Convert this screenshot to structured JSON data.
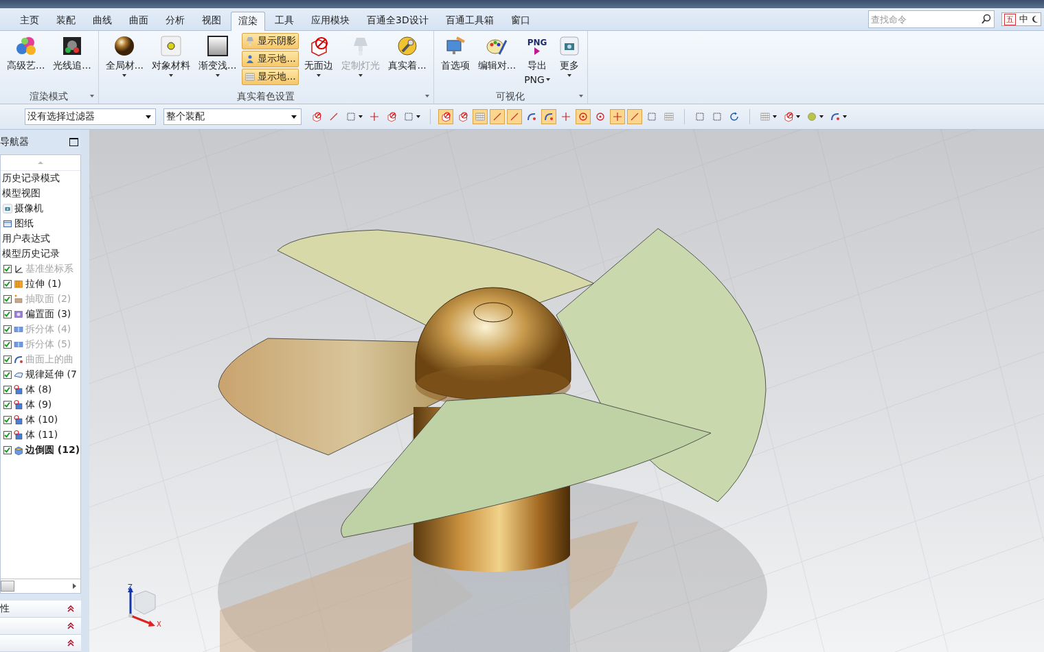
{
  "tabs": [
    {
      "label": "主页",
      "selected": false
    },
    {
      "label": "装配",
      "selected": false
    },
    {
      "label": "曲线",
      "selected": false
    },
    {
      "label": "曲面",
      "selected": false
    },
    {
      "label": "分析",
      "selected": false
    },
    {
      "label": "视图",
      "selected": false
    },
    {
      "label": "渲染",
      "selected": true
    },
    {
      "label": "工具",
      "selected": false
    },
    {
      "label": "应用模块",
      "selected": false
    },
    {
      "label": "百通全3D设计",
      "selected": false
    },
    {
      "label": "百通工具箱",
      "selected": false
    },
    {
      "label": "窗口",
      "selected": false
    }
  ],
  "search": {
    "placeholder": "查找命令"
  },
  "ime": {
    "labels": [
      "五",
      "中"
    ]
  },
  "ribbon": {
    "groups": [
      {
        "label": "渲染模式",
        "items": [
          {
            "kind": "large",
            "label": "高级艺...",
            "disabled": false,
            "dropdown": false
          },
          {
            "kind": "large",
            "label": "光线追...",
            "disabled": false,
            "dropdown": false
          }
        ]
      },
      {
        "label": "真实着色设置",
        "items": [
          {
            "kind": "large",
            "label": "全局材...",
            "disabled": false,
            "dropdown": true
          },
          {
            "kind": "large",
            "label": "对象材料",
            "disabled": false,
            "dropdown": true
          },
          {
            "kind": "large",
            "label": "渐变浅...",
            "disabled": false,
            "dropdown": true
          },
          {
            "kind": "stack",
            "buttons": [
              {
                "label": "显示阴影",
                "on": true
              },
              {
                "label": "显示地...",
                "on": true
              },
              {
                "label": "显示地...",
                "on": true
              }
            ]
          },
          {
            "kind": "large",
            "label": "无面边",
            "disabled": false,
            "dropdown": true
          },
          {
            "kind": "large",
            "label": "定制灯光",
            "disabled": true,
            "dropdown": true
          },
          {
            "kind": "large",
            "label": "真实着...",
            "disabled": false,
            "dropdown": false
          }
        ]
      },
      {
        "label": "可视化",
        "items": [
          {
            "kind": "large",
            "label": "首选项",
            "disabled": false,
            "dropdown": false
          },
          {
            "kind": "large",
            "label": "编辑对...",
            "disabled": false,
            "dropdown": false
          },
          {
            "kind": "large",
            "label": "导出",
            "icon_text": "PNG",
            "sub_label": "PNG",
            "disabled": false,
            "dropdown": true
          },
          {
            "kind": "large",
            "label": "更多",
            "disabled": false,
            "dropdown": true
          }
        ]
      }
    ]
  },
  "toolbar": {
    "filter": "没有选择过滤器",
    "scope": "整个装配",
    "tools": [
      {
        "on": false,
        "dropdown": false
      },
      {
        "on": false,
        "dropdown": false
      },
      {
        "on": false,
        "dropdown": true
      },
      {
        "on": false,
        "dropdown": false
      },
      {
        "on": false,
        "dropdown": false
      },
      {
        "on": false,
        "dropdown": true
      },
      {
        "on": true,
        "dropdown": false
      },
      {
        "on": false,
        "dropdown": false
      },
      {
        "on": true,
        "dropdown": false
      },
      {
        "on": true,
        "dropdown": false
      },
      {
        "on": true,
        "dropdown": false
      },
      {
        "on": false,
        "dropdown": false
      },
      {
        "on": true,
        "dropdown": false
      },
      {
        "on": false,
        "dropdown": false
      },
      {
        "on": true,
        "dropdown": false
      },
      {
        "on": false,
        "dropdown": false
      },
      {
        "on": true,
        "dropdown": false
      },
      {
        "on": true,
        "dropdown": false
      },
      {
        "on": false,
        "dropdown": false
      },
      {
        "on": false,
        "dropdown": false
      },
      {
        "on": false,
        "dropdown": false
      },
      {
        "on": false,
        "dropdown": false
      },
      {
        "on": false,
        "dropdown": false
      },
      {
        "on": false,
        "dropdown": true
      },
      {
        "on": false,
        "dropdown": true
      },
      {
        "on": false,
        "dropdown": true
      },
      {
        "on": false,
        "dropdown": true
      }
    ]
  },
  "navigator": {
    "title": "导航器",
    "items": [
      {
        "kind": "node",
        "label": "历史记录模式"
      },
      {
        "kind": "node",
        "label": "模型视图"
      },
      {
        "kind": "node",
        "label": "摄像机"
      },
      {
        "kind": "node",
        "label": "图纸"
      },
      {
        "kind": "node",
        "label": "用户表达式"
      },
      {
        "kind": "node",
        "label": "模型历史记录"
      },
      {
        "kind": "feature",
        "label": "基准坐标系",
        "checked": true,
        "disabled": true,
        "current": false
      },
      {
        "kind": "feature",
        "label": "拉伸 (1)",
        "checked": true,
        "disabled": false,
        "current": false
      },
      {
        "kind": "feature",
        "label": "抽取面 (2)",
        "checked": true,
        "disabled": true,
        "current": false
      },
      {
        "kind": "feature",
        "label": "偏置面 (3)",
        "checked": true,
        "disabled": false,
        "current": false
      },
      {
        "kind": "feature",
        "label": "拆分体 (4)",
        "checked": true,
        "disabled": true,
        "current": false
      },
      {
        "kind": "feature",
        "label": "拆分体 (5)",
        "checked": true,
        "disabled": true,
        "current": false
      },
      {
        "kind": "feature",
        "label": "曲面上的曲",
        "checked": true,
        "disabled": true,
        "current": false
      },
      {
        "kind": "feature",
        "label": "规律延伸 (7",
        "checked": true,
        "disabled": false,
        "current": false
      },
      {
        "kind": "feature",
        "label": "体 (8)",
        "checked": true,
        "disabled": false,
        "current": false
      },
      {
        "kind": "feature",
        "label": "体 (9)",
        "checked": true,
        "disabled": false,
        "current": false
      },
      {
        "kind": "feature",
        "label": "体 (10)",
        "checked": true,
        "disabled": false,
        "current": false
      },
      {
        "kind": "feature",
        "label": "体 (11)",
        "checked": true,
        "disabled": false,
        "current": false
      },
      {
        "kind": "feature",
        "label": "边倒圆 (12)",
        "checked": true,
        "disabled": false,
        "current": true
      }
    ],
    "panels": [
      {
        "label": "性",
        "expanded": false
      },
      {
        "expanded": false
      },
      {
        "expanded": false
      }
    ]
  },
  "viewport": {
    "triad": {
      "z": "Z",
      "x": "X"
    }
  }
}
